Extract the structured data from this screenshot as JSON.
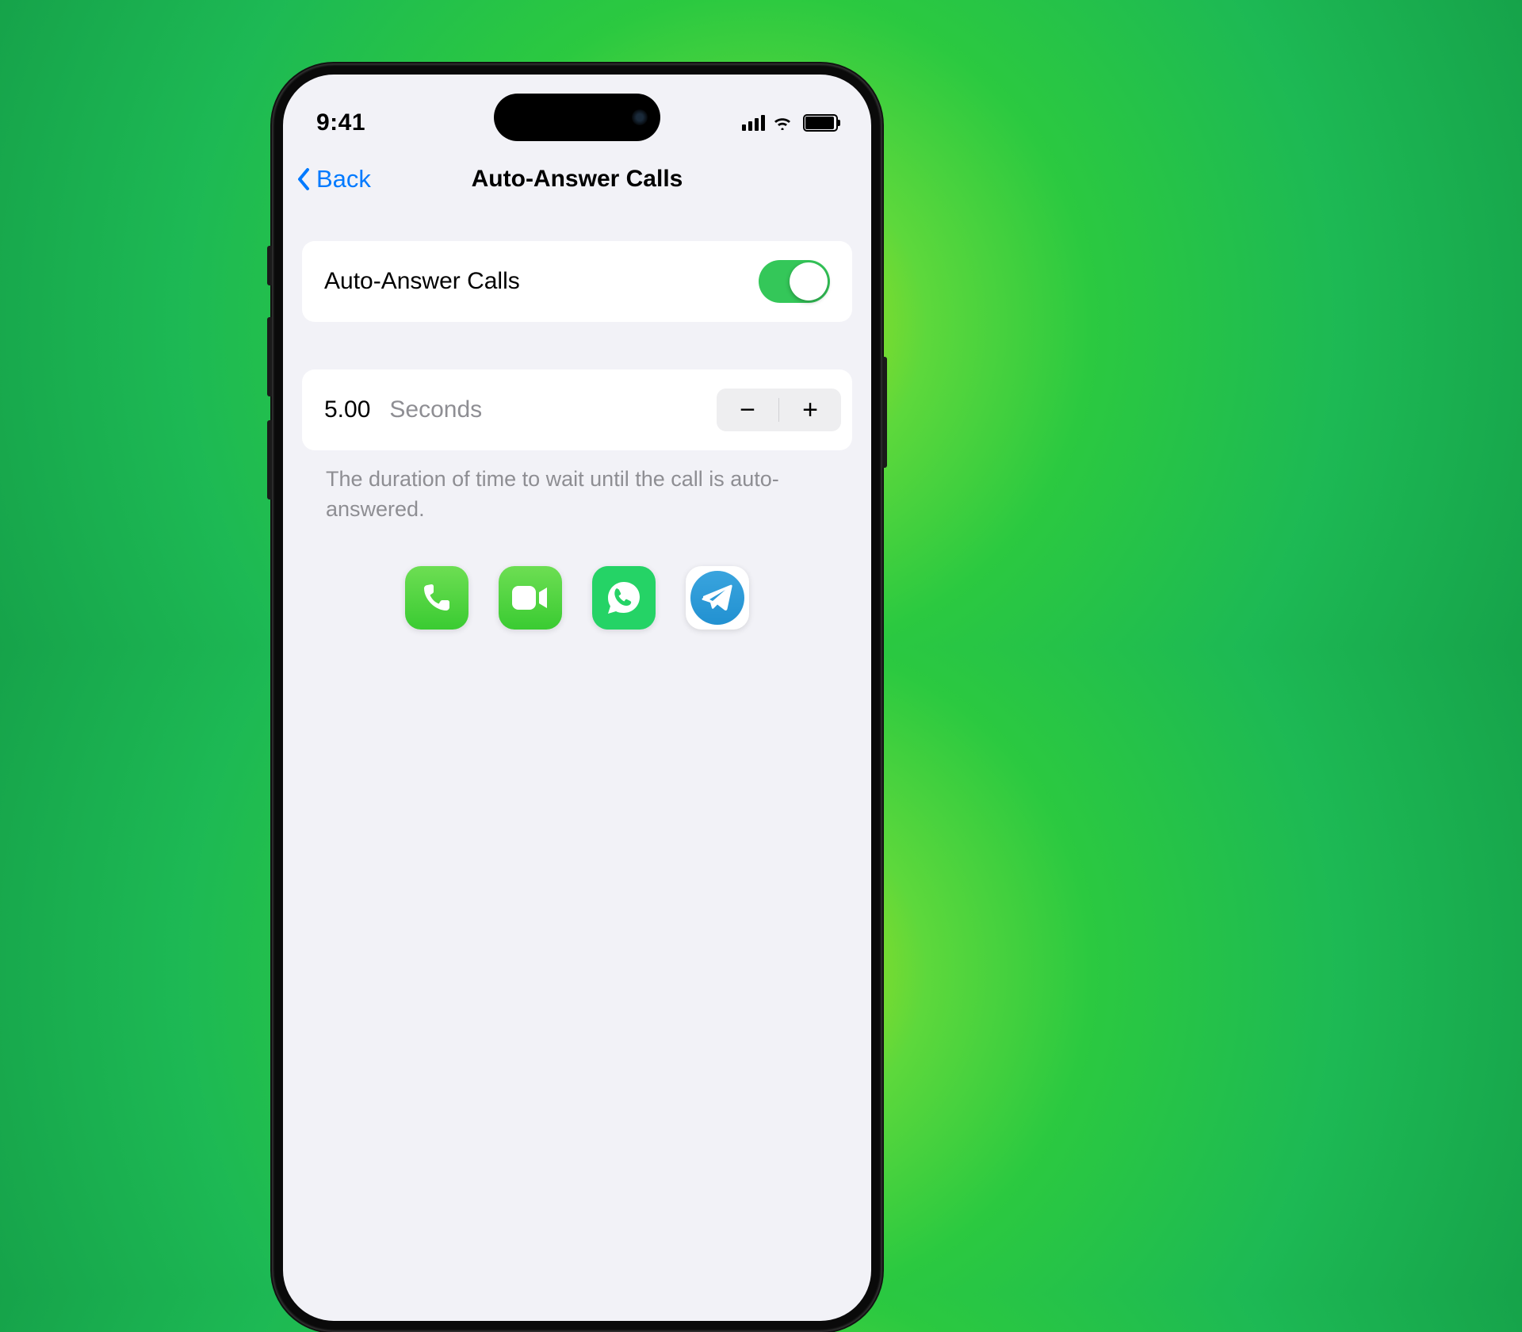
{
  "status": {
    "time": "9:41"
  },
  "nav": {
    "back_label": "Back",
    "title": "Auto-Answer Calls"
  },
  "settings": {
    "toggle_label": "Auto-Answer Calls",
    "toggle_on": true,
    "duration_value": "5.00",
    "duration_unit": "Seconds",
    "stepper_minus": "−",
    "stepper_plus": "+",
    "description": "The duration of time to wait until the call is auto-answered."
  },
  "apps": [
    {
      "name": "phone"
    },
    {
      "name": "facetime"
    },
    {
      "name": "whatsapp"
    },
    {
      "name": "telegram"
    }
  ]
}
